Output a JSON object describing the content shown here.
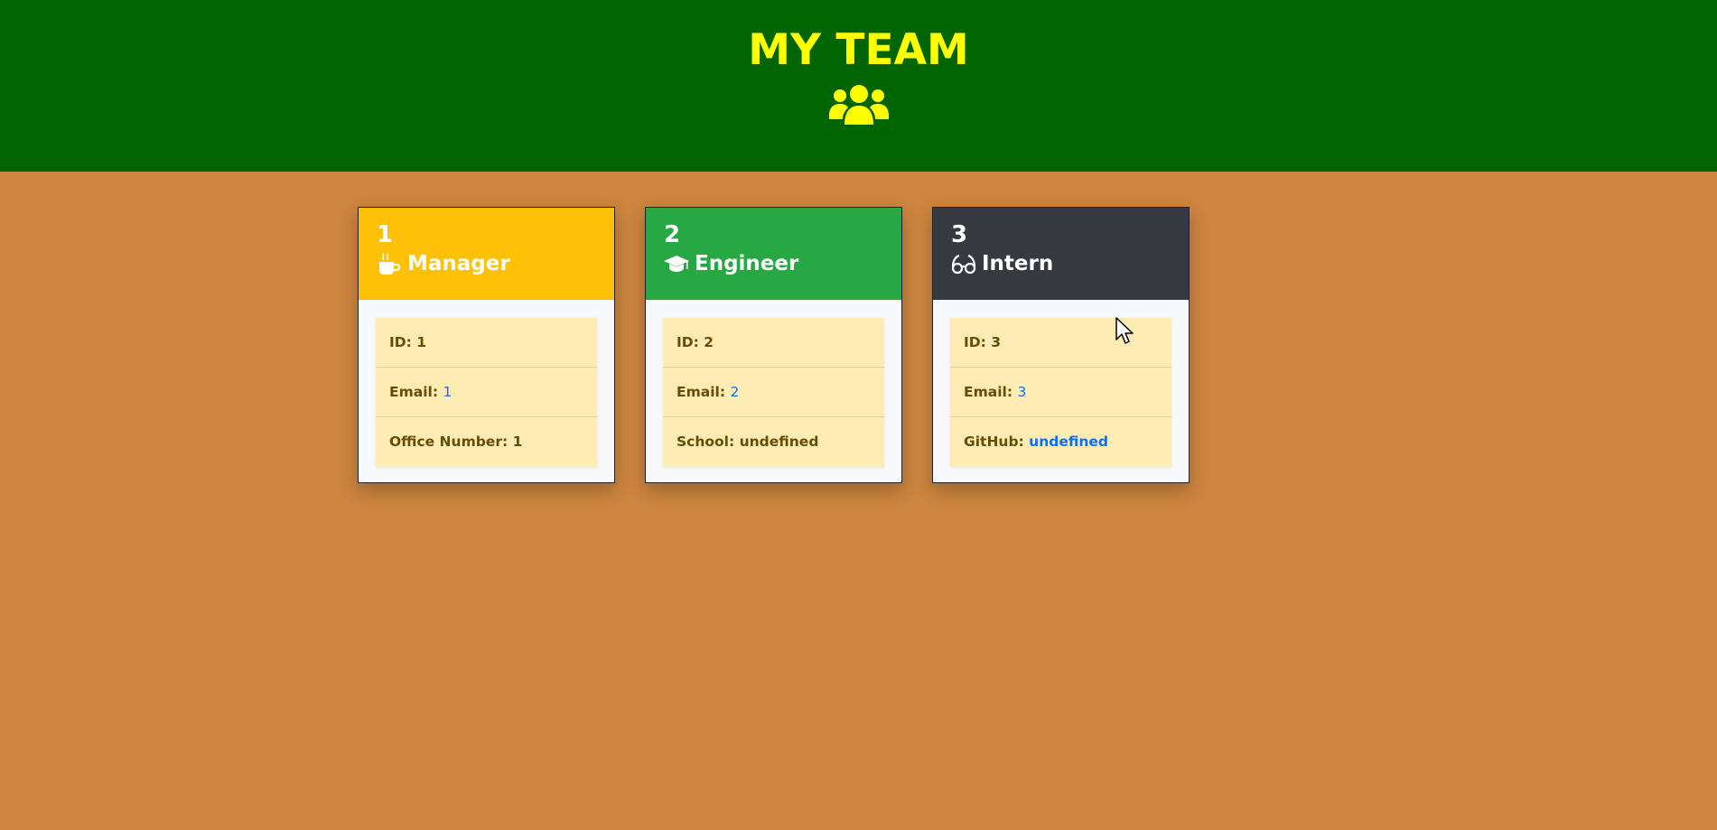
{
  "header": {
    "title": "MY TEAM",
    "icon": "users-icon",
    "background": "#006400",
    "title_color": "#ffff00"
  },
  "page": {
    "background": "#cd853f"
  },
  "cards": [
    {
      "name": "1",
      "role": "Manager",
      "role_icon": "mug-hot-icon",
      "header_color": "#ffc107",
      "id_label": "ID:",
      "id_value": "1",
      "email_label": "Email:",
      "email_value": "1",
      "extra_label": "Office Number:",
      "extra_value": "1"
    },
    {
      "name": "2",
      "role": "Engineer",
      "role_icon": "graduation-cap-icon",
      "header_color": "#28a745",
      "id_label": "ID:",
      "id_value": "2",
      "email_label": "Email:",
      "email_value": "2",
      "extra_label": "School:",
      "extra_value": "undefined"
    },
    {
      "name": "3",
      "role": "Intern",
      "role_icon": "glasses-icon",
      "header_color": "#343a40",
      "id_label": "ID:",
      "id_value": "3",
      "email_label": "Email:",
      "email_value": "3",
      "extra_label": "GitHub:",
      "extra_value": "undefined"
    }
  ]
}
